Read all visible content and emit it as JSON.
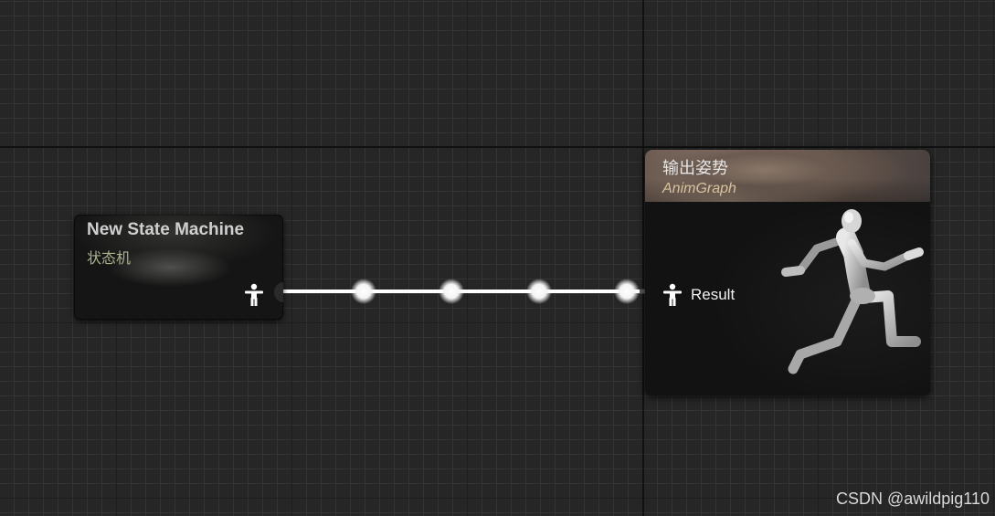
{
  "state_machine_node": {
    "title": "New State Machine",
    "subtitle": "状态机",
    "output_pin_icon": "pose-person-icon"
  },
  "output_pose_node": {
    "title": "输出姿势",
    "subtitle": "AnimGraph",
    "input_pin_icon": "pose-person-icon",
    "input_pin_label": "Result",
    "preview_icon": "running-mannequin-icon"
  },
  "connection": {
    "from": "New State Machine",
    "to": "Result"
  },
  "watermark": "CSDN @awildpig110",
  "colors": {
    "graph_background": "#262626",
    "wire": "#ffffff",
    "node_header_accent": "#8a7768",
    "subtitle_green": "#aab38e"
  }
}
